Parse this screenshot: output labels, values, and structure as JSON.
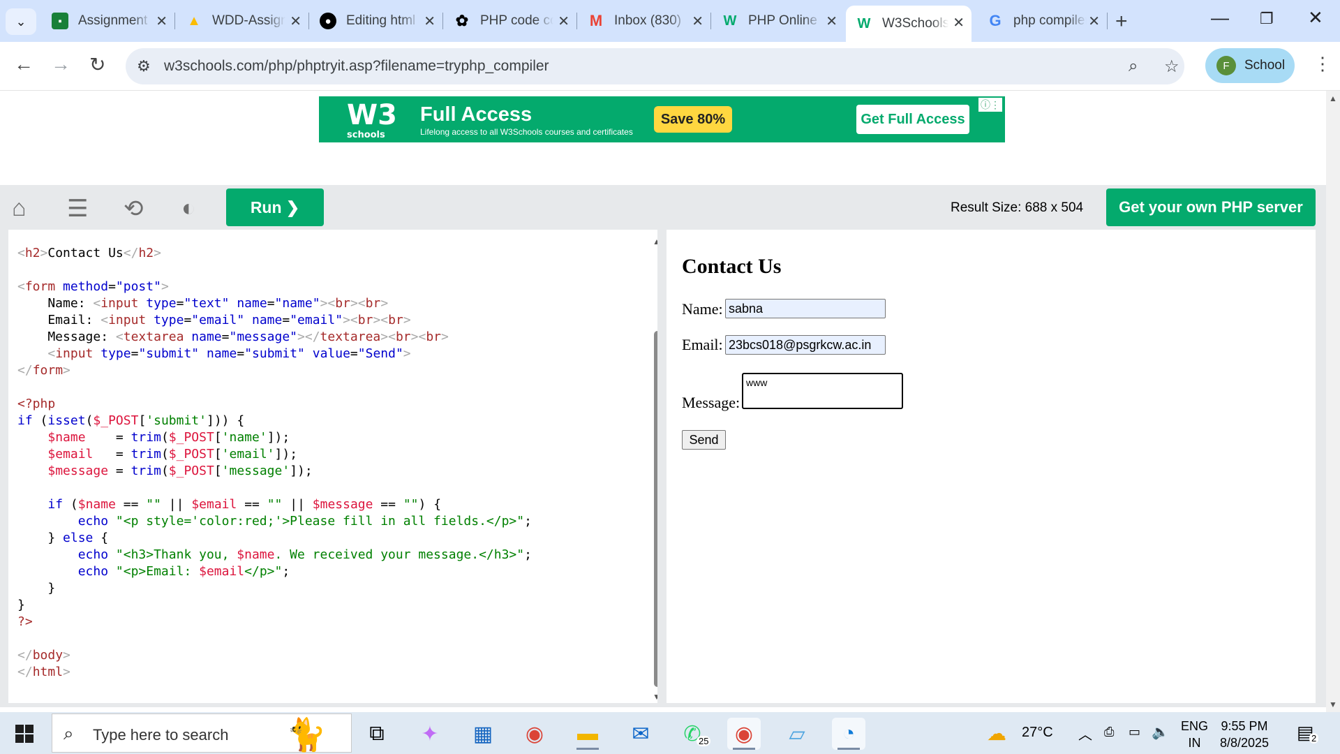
{
  "browser": {
    "tabs": [
      {
        "title": "Assignment",
        "icon": "classroom-icon",
        "color": "#188038"
      },
      {
        "title": "WDD-Assignment",
        "icon": "drive-icon",
        "color": "#fbbc04"
      },
      {
        "title": "Editing html",
        "icon": "github-icon",
        "color": "#000000"
      },
      {
        "title": "PHP code compiler",
        "icon": "chatgpt-icon",
        "color": "#000000"
      },
      {
        "title": "Inbox (830)",
        "icon": "gmail-icon",
        "color": "#ea4335"
      },
      {
        "title": "PHP Online Compiler",
        "icon": "w3schools-icon",
        "color": "#04aa6d"
      },
      {
        "title": "W3Schools",
        "icon": "w3schools-icon",
        "color": "#04aa6d",
        "active": true
      },
      {
        "title": "php compiler",
        "icon": "google-icon",
        "color": "#4285f4"
      }
    ],
    "url": "w3schools.com/php/phptryit.asp?filename=tryphp_compiler",
    "profile": {
      "initial": "F",
      "label": "School"
    }
  },
  "ad": {
    "logo": "W3",
    "logo_sub": "schools",
    "headline": "Full Access",
    "subline": "Lifelong access to all W3Schools courses and certificates",
    "save_label": "Save 80%",
    "cta_label": "Get Full Access"
  },
  "editor_toolbar": {
    "run_label": "Run ❯",
    "result_size": "Result Size: 688 x 504",
    "server_label": "Get your own PHP server"
  },
  "result": {
    "heading": "Contact Us",
    "name_label": "Name:",
    "name_value": "sabna",
    "email_label": "Email:",
    "email_value": "23bcs018@psgrkcw.ac.in",
    "message_label": "Message:",
    "message_value": "www",
    "send_label": "Send"
  },
  "taskbar": {
    "search_placeholder": "Type here to search",
    "weather": "27°C",
    "lang_top": "ENG",
    "lang_bottom": "IN",
    "time": "9:55 PM",
    "date": "8/8/2025",
    "whatsapp_badge": "25",
    "notif_badge": "2"
  }
}
